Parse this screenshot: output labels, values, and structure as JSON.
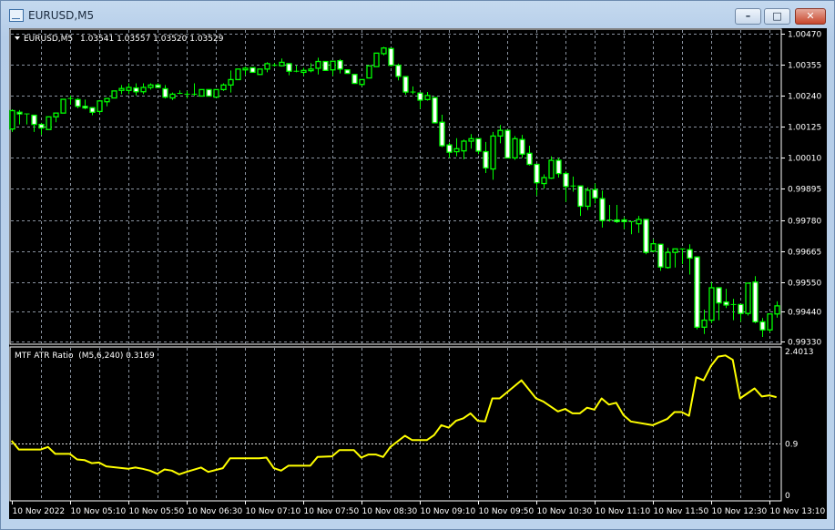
{
  "window": {
    "title": "EURUSD,M5",
    "minimize_glyph": "–",
    "maximize_glyph": "□",
    "close_glyph": "✕"
  },
  "main_panel": {
    "symbol_label": "EURUSD,M5",
    "ohlc_text": "1.03541 1.03557 1.03520 1.03529",
    "dropdown_icon": "triangle-down-icon"
  },
  "indicator_panel": {
    "label": "MTF ATR Ratio  (M5,6,240) 0.3169"
  },
  "colors": {
    "background": "#000000",
    "candle_outline": "#00ff00",
    "bear_body": "#ffffff",
    "bull_body": "#000000",
    "indicator_line": "#ffff00",
    "grid": "#8a93a0",
    "text": "#ffffff"
  },
  "chart_data": [
    {
      "type": "candlestick",
      "ylim": [
        0.9933,
        1.0047
      ],
      "y_tick_labels": [
        "1.00470",
        "1.00355",
        "1.00240",
        "1.00125",
        "1.00010",
        "0.99895",
        "0.99780",
        "0.99665",
        "0.99550",
        "0.99440",
        "0.99330"
      ],
      "grid": true,
      "ohlc": [
        [
          1.00117,
          1.0019,
          1.00106,
          1.00185
        ],
        [
          1.00179,
          1.00187,
          1.00134,
          1.00173
        ],
        [
          1.00173,
          1.00173,
          1.00134,
          1.0017
        ],
        [
          1.00168,
          1.0017,
          1.00106,
          1.00134
        ],
        [
          1.00134,
          1.0014,
          1.00095,
          1.00121
        ],
        [
          1.00115,
          1.00162,
          1.00115,
          1.00162
        ],
        [
          1.00162,
          1.00176,
          1.00142,
          1.00176
        ],
        [
          1.00176,
          1.00227,
          1.00176,
          1.00227
        ],
        [
          1.00227,
          1.00241,
          1.00207,
          1.0023
        ],
        [
          1.00226,
          1.00232,
          1.00194,
          1.00201
        ],
        [
          1.00201,
          1.00226,
          1.0019,
          1.00195
        ],
        [
          1.00196,
          1.00196,
          1.00168,
          1.00179
        ],
        [
          1.00182,
          1.00224,
          1.00173,
          1.00221
        ],
        [
          1.00218,
          1.0023,
          1.00201,
          1.0023
        ],
        [
          1.00232,
          1.00258,
          1.00232,
          1.00258
        ],
        [
          1.0026,
          1.0028,
          1.00246,
          1.00267
        ],
        [
          1.0026,
          1.00286,
          1.00246,
          1.00271
        ],
        [
          1.00269,
          1.00286,
          1.00241,
          1.00255
        ],
        [
          1.00255,
          1.00286,
          1.00246,
          1.00271
        ],
        [
          1.00271,
          1.00286,
          1.00263,
          1.0028
        ],
        [
          1.0028,
          1.00286,
          1.00269,
          1.00271
        ],
        [
          1.00266,
          1.0028,
          1.0023,
          1.00235
        ],
        [
          1.00232,
          1.00252,
          1.00224,
          1.00246
        ],
        [
          1.00249,
          1.0026,
          1.00246,
          1.00249
        ],
        [
          1.00246,
          1.00258,
          1.0023,
          1.00246
        ],
        [
          1.00246,
          1.00286,
          1.00239,
          1.00241
        ],
        [
          1.00239,
          1.00263,
          1.00239,
          1.00263
        ],
        [
          1.00263,
          1.00263,
          1.00239,
          1.00239
        ],
        [
          1.00235,
          1.00263,
          1.00235,
          1.00263
        ],
        [
          1.00263,
          1.00286,
          1.00258,
          1.0028
        ],
        [
          1.0028,
          1.00334,
          1.00252,
          1.003
        ],
        [
          1.003,
          1.00339,
          1.003,
          1.00339
        ],
        [
          1.00336,
          1.00348,
          1.00316,
          1.00342
        ],
        [
          1.00344,
          1.00344,
          1.00327,
          1.00327
        ],
        [
          1.00319,
          1.00339,
          1.00319,
          1.00339
        ],
        [
          1.00339,
          1.00364,
          1.00327,
          1.00359
        ],
        [
          1.00353,
          1.00361,
          1.00348,
          1.00353
        ],
        [
          1.00351,
          1.00378,
          1.00348,
          1.00364
        ],
        [
          1.00359,
          1.00359,
          1.00316,
          1.00331
        ],
        [
          1.00331,
          1.00353,
          1.00327,
          1.00331
        ],
        [
          1.00327,
          1.00344,
          1.00314,
          1.00334
        ],
        [
          1.00333,
          1.00361,
          1.00327,
          1.00339
        ],
        [
          1.00342,
          1.00381,
          1.00319,
          1.00367
        ],
        [
          1.00367,
          1.00367,
          1.00334,
          1.00334
        ],
        [
          1.00336,
          1.00368,
          1.00314,
          1.00368
        ],
        [
          1.0037,
          1.00376,
          1.00323,
          1.00339
        ],
        [
          1.00336,
          1.00336,
          1.00323,
          1.00323
        ],
        [
          1.00319,
          1.00319,
          1.00286,
          1.00286
        ],
        [
          1.00282,
          1.003,
          1.00275,
          1.003
        ],
        [
          1.00306,
          1.00351,
          1.00306,
          1.00351
        ],
        [
          1.00348,
          1.00398,
          1.00348,
          1.00398
        ],
        [
          1.00396,
          1.00421,
          1.0039,
          1.00417
        ],
        [
          1.00415,
          1.00415,
          1.00348,
          1.00353
        ],
        [
          1.00353,
          1.00359,
          1.00297,
          1.00312
        ],
        [
          1.00311,
          1.00311,
          1.00244,
          1.00254
        ],
        [
          1.00254,
          1.00275,
          1.00246,
          1.00254
        ],
        [
          1.0025,
          1.0025,
          1.00192,
          1.00224
        ],
        [
          1.00226,
          1.00254,
          1.00222,
          1.00241
        ],
        [
          1.00233,
          1.00233,
          1.0014,
          1.0014
        ],
        [
          1.00142,
          1.0017,
          1.0005,
          1.00055
        ],
        [
          1.00058,
          1.00067,
          1.0001,
          1.00031
        ],
        [
          1.00033,
          1.00083,
          1.00016,
          1.00044
        ],
        [
          1.00036,
          1.00078,
          1.00005,
          1.00072
        ],
        [
          1.00072,
          1.00098,
          1.00044,
          1.00081
        ],
        [
          1.00081,
          1.00081,
          1.00024,
          1.00035
        ],
        [
          1.00033,
          1.00069,
          0.99954,
          0.99973
        ],
        [
          0.99969,
          1.00106,
          0.99929,
          1.00091
        ],
        [
          1.00091,
          1.00132,
          1.00064,
          1.00112
        ],
        [
          1.00112,
          1.00112,
          1.0001,
          1.0001
        ],
        [
          1.0001,
          1.00091,
          1.00003,
          1.00081
        ],
        [
          1.00078,
          1.00095,
          1.0001,
          1.00024
        ],
        [
          1.00027,
          1.00055,
          0.99982,
          0.99986
        ],
        [
          0.99986,
          0.99986,
          0.9987,
          0.99918
        ],
        [
          0.99915,
          0.99949,
          0.99896,
          0.99937
        ],
        [
          0.99935,
          1.00016,
          0.99932,
          1.00001
        ],
        [
          1.00001,
          1.0001,
          0.99937,
          0.99952
        ],
        [
          0.99952,
          0.9996,
          0.99847,
          0.99904
        ],
        [
          0.99904,
          0.99941,
          0.99885,
          0.99906
        ],
        [
          0.99906,
          0.99906,
          0.99795,
          0.99831
        ],
        [
          0.99831,
          0.99901,
          0.99817,
          0.9989
        ],
        [
          0.99892,
          0.99915,
          0.99842,
          0.99862
        ],
        [
          0.99859,
          0.99889,
          0.99752,
          0.99778
        ],
        [
          0.99778,
          0.99836,
          0.99774,
          0.9978
        ],
        [
          0.9978,
          0.99836,
          0.99769,
          0.99774
        ],
        [
          0.9978,
          0.99791,
          0.99746,
          0.99774
        ],
        [
          0.99774,
          0.99774,
          0.99727,
          0.99769
        ],
        [
          0.99766,
          0.99795,
          0.99732,
          0.99782
        ],
        [
          0.99782,
          0.99782,
          0.99653,
          0.9966
        ],
        [
          0.99665,
          0.99709,
          0.9966,
          0.99692
        ],
        [
          0.9969,
          0.9969,
          0.99592,
          0.99606
        ],
        [
          0.99604,
          0.99677,
          0.996,
          0.9966
        ],
        [
          0.9966,
          0.99673,
          0.99604,
          0.99673
        ],
        [
          0.99673,
          0.99673,
          0.99617,
          0.9967
        ],
        [
          0.9967,
          0.9969,
          0.99578,
          0.99639
        ],
        [
          0.99643,
          0.99643,
          0.99375,
          0.99383
        ],
        [
          0.99383,
          0.99448,
          0.99358,
          0.99409
        ],
        [
          0.99409,
          0.9955,
          0.99398,
          0.99529
        ],
        [
          0.99529,
          0.99529,
          0.99409,
          0.99473
        ],
        [
          0.99476,
          0.99525,
          0.99454,
          0.99465
        ],
        [
          0.99465,
          0.99488,
          0.99409,
          0.99467
        ],
        [
          0.99467,
          0.99467,
          0.99403,
          0.99434
        ],
        [
          0.99434,
          0.99546,
          0.99426,
          0.99546
        ],
        [
          0.9955,
          0.99572,
          0.99398,
          0.99403
        ],
        [
          0.99403,
          0.99417,
          0.99347,
          0.99373
        ],
        [
          0.99373,
          0.99432,
          0.99364,
          0.99432
        ],
        [
          0.99432,
          0.99479,
          0.99418,
          0.99462
        ]
      ]
    },
    {
      "type": "line",
      "ylim": [
        0,
        2.4013
      ],
      "y_tick_labels": [
        "2.4013",
        "0.9",
        "0"
      ],
      "level_line": 0.9,
      "series": [
        {
          "points": [
            [
              "04:30",
              0.95
            ],
            [
              "04:35",
              0.81
            ],
            [
              "04:50",
              0.81
            ],
            [
              "04:55",
              0.85
            ],
            [
              "05:00",
              0.74
            ],
            [
              "05:10",
              0.74
            ],
            [
              "05:15",
              0.65
            ],
            [
              "05:20",
              0.64
            ],
            [
              "05:25",
              0.59
            ],
            [
              "05:30",
              0.6
            ],
            [
              "05:35",
              0.54
            ],
            [
              "05:50",
              0.5
            ],
            [
              "05:55",
              0.52
            ],
            [
              "06:00",
              0.5
            ],
            [
              "06:05",
              0.47
            ],
            [
              "06:10",
              0.42
            ],
            [
              "06:15",
              0.49
            ],
            [
              "06:20",
              0.47
            ],
            [
              "06:25",
              0.41
            ],
            [
              "06:30",
              0.45
            ],
            [
              "06:40",
              0.52
            ],
            [
              "06:45",
              0.45
            ],
            [
              "06:55",
              0.51
            ],
            [
              "07:00",
              0.67
            ],
            [
              "07:20",
              0.67
            ],
            [
              "07:25",
              0.68
            ],
            [
              "07:30",
              0.51
            ],
            [
              "07:35",
              0.47
            ],
            [
              "07:40",
              0.55
            ],
            [
              "07:55",
              0.55
            ],
            [
              "08:00",
              0.69
            ],
            [
              "08:10",
              0.7
            ],
            [
              "08:15",
              0.8
            ],
            [
              "08:25",
              0.8
            ],
            [
              "08:30",
              0.68
            ],
            [
              "08:35",
              0.73
            ],
            [
              "08:40",
              0.73
            ],
            [
              "08:45",
              0.69
            ],
            [
              "08:50",
              0.85
            ],
            [
              "09:00",
              1.03
            ],
            [
              "09:05",
              0.96
            ],
            [
              "09:15",
              0.96
            ],
            [
              "09:20",
              1.04
            ],
            [
              "09:25",
              1.2
            ],
            [
              "09:30",
              1.16
            ],
            [
              "09:35",
              1.27
            ],
            [
              "09:40",
              1.31
            ],
            [
              "09:45",
              1.39
            ],
            [
              "09:50",
              1.27
            ],
            [
              "09:55",
              1.26
            ],
            [
              "10:00",
              1.63
            ],
            [
              "10:05",
              1.63
            ],
            [
              "10:20",
              1.92
            ],
            [
              "10:30",
              1.63
            ],
            [
              "10:35",
              1.58
            ],
            [
              "10:45",
              1.42
            ],
            [
              "10:50",
              1.46
            ],
            [
              "10:55",
              1.39
            ],
            [
              "11:00",
              1.39
            ],
            [
              "11:05",
              1.48
            ],
            [
              "11:10",
              1.45
            ],
            [
              "11:15",
              1.63
            ],
            [
              "11:20",
              1.53
            ],
            [
              "11:25",
              1.56
            ],
            [
              "11:30",
              1.36
            ],
            [
              "11:35",
              1.26
            ],
            [
              "11:50",
              1.2
            ],
            [
              "12:00",
              1.3
            ],
            [
              "12:05",
              1.41
            ],
            [
              "12:10",
              1.41
            ],
            [
              "12:15",
              1.35
            ],
            [
              "12:20",
              1.97
            ],
            [
              "12:25",
              1.92
            ],
            [
              "12:30",
              2.15
            ],
            [
              "12:35",
              2.3
            ],
            [
              "12:40",
              2.32
            ],
            [
              "12:45",
              2.25
            ],
            [
              "12:50",
              1.63
            ],
            [
              "13:00",
              1.79
            ],
            [
              "13:05",
              1.66
            ],
            [
              "13:10",
              1.68
            ],
            [
              "13:15",
              1.65
            ]
          ]
        }
      ]
    }
  ],
  "time_axis": {
    "labels": [
      "10 Nov 2022",
      "10 Nov 05:10",
      "10 Nov 05:50",
      "10 Nov 06:30",
      "10 Nov 07:10",
      "10 Nov 07:50",
      "10 Nov 08:30",
      "10 Nov 09:10",
      "10 Nov 09:50",
      "10 Nov 10:30",
      "10 Nov 11:10",
      "10 Nov 11:50",
      "10 Nov 12:30",
      "10 Nov 13:10"
    ]
  }
}
